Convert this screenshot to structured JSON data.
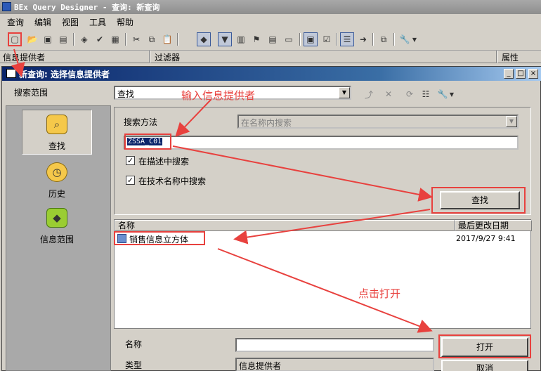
{
  "window": {
    "title": "BEx Query Designer - 查询: 新查询"
  },
  "menu": [
    "查询",
    "编辑",
    "视图",
    "工具",
    "帮助"
  ],
  "panels": {
    "infoprovider": "信息提供者",
    "filter": "过滤器",
    "properties": "属性"
  },
  "dialog": {
    "title": "新查询: 选择信息提供者",
    "search_scope_label": "搜索范围",
    "scope_value": "查找",
    "sidebar": [
      "查找",
      "历史",
      "信息范围"
    ],
    "search_method_label": "搜索方法",
    "search_method_value": "在名称内搜索",
    "search_text": "ZSSA_C01",
    "check_description": "在描述中搜索",
    "check_technical": "在技术名称中搜索",
    "find_button": "查找",
    "columns": {
      "name": "名称",
      "date": "最后更改日期"
    },
    "results": [
      {
        "name": "销售信息立方体",
        "date": "2017/9/27  9:41"
      }
    ],
    "name_label": "名称",
    "name_value": "",
    "type_label": "类型",
    "type_value": "信息提供者",
    "open_button": "打开",
    "cancel_button": "取消"
  },
  "annotations": {
    "enter_provider": "输入信息提供者",
    "click_open": "点击打开"
  },
  "colors": {
    "annotation": "#e8413e",
    "title_bar": "#0a246a"
  }
}
